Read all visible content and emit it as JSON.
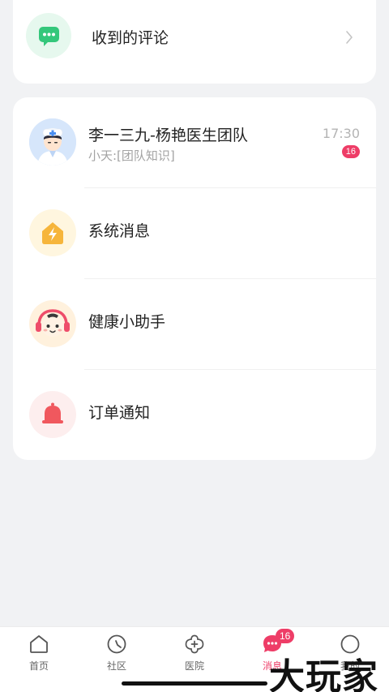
{
  "comments": {
    "title": "收到的评论"
  },
  "conversations": [
    {
      "title": "李一三九-杨艳医生团队",
      "subtitle": "小天:[团队知识]",
      "time": "17:30",
      "unread": "16",
      "icon": "doctor-avatar"
    },
    {
      "title": "系统消息",
      "icon": "lightning-house-icon"
    },
    {
      "title": "健康小助手",
      "icon": "robot-headphone-icon"
    },
    {
      "title": "订单通知",
      "icon": "bell-icon"
    }
  ],
  "tabbar": {
    "items": [
      {
        "label": "首页",
        "icon": "home-icon"
      },
      {
        "label": "社区",
        "icon": "compass-icon"
      },
      {
        "label": "医院",
        "icon": "hospital-icon"
      },
      {
        "label": "消息",
        "icon": "message-icon",
        "badge": "16",
        "active": true
      },
      {
        "label": "我的",
        "icon": "profile-icon"
      }
    ]
  },
  "colors": {
    "accent": "#ee3d67",
    "green": "#34c77b",
    "orange": "#f6b53b",
    "red": "#f0585e",
    "background": "#f1f2f4"
  },
  "watermark": "大玩家"
}
